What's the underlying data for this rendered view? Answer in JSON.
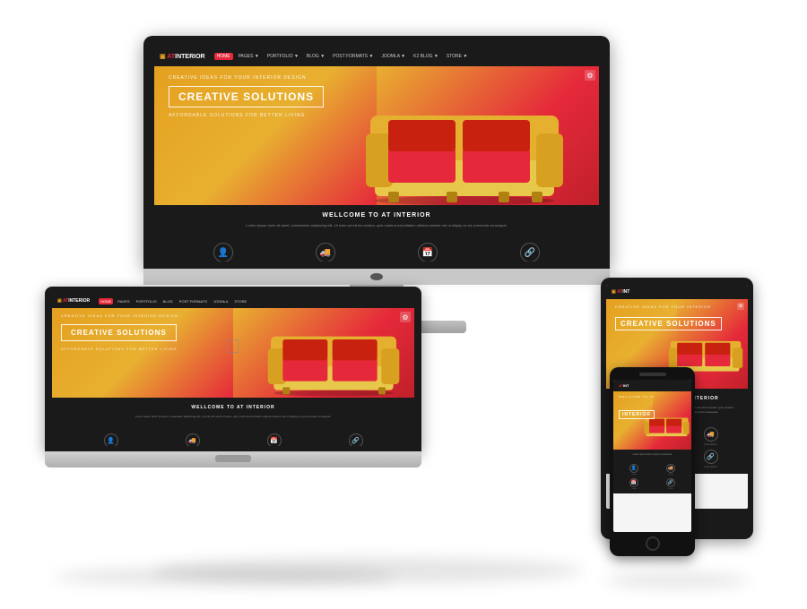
{
  "scene": {
    "background": "#ffffff"
  },
  "website": {
    "logo": "AT INTERIOR",
    "logo_brand": "AT",
    "logo_suffix": "INTERIOR",
    "nav_items": [
      "HOME",
      "PAGES ▼",
      "PORTFOLIO ▼",
      "BLOG ▼",
      "POST FORMATS ▼",
      "JOOMLA ▼",
      "K2 BLOG ▼",
      "STORE ▼"
    ],
    "hero_subtitle": "CREATIVE IDEAS FOR YOUR INTERIOR DESIGN",
    "hero_title": "CREATIVE SOLUTIONS",
    "hero_tagline": "AFFORDABLE SOLUTIONS FOR BETTER LIVING",
    "content_heading": "WELLCOME TO AT INTERIOR",
    "content_text": "Lorem ipsum dolor sit amet, consectetur adipiscing elit. Ut enim ad minim veniam, quis nostrud exercitation ullamco laboris nisi ut aliquip ex ea commodo consequat.",
    "icons": [
      "👤",
      "🚚",
      "📅",
      "🔗"
    ]
  },
  "devices": {
    "monitor": "Desktop iMac",
    "laptop": "MacBook",
    "tablet": "iPad",
    "phone": "iPhone"
  }
}
